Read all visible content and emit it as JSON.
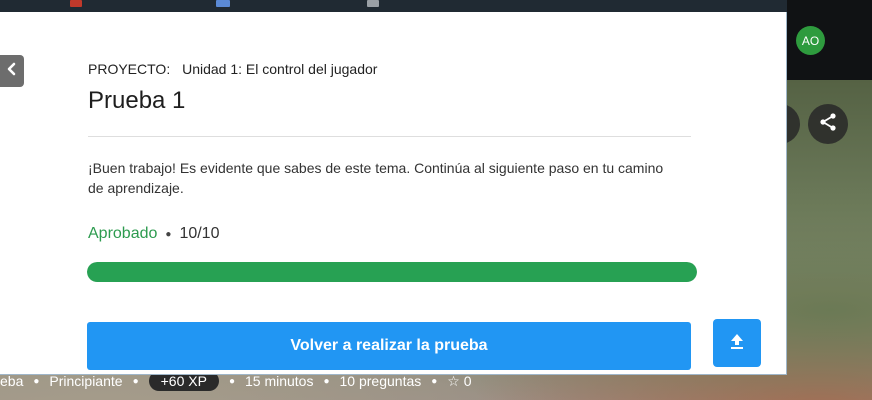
{
  "colors": {
    "accent": "#2196f3",
    "success": "#27a153",
    "avatar_bg": "#2e9b3e"
  },
  "user": {
    "initials": "AO"
  },
  "modal": {
    "project_label": "PROYECTO:",
    "project_name": "Unidad 1: El control del jugador",
    "title": "Prueba 1",
    "message": "¡Buen trabajo! Es evidente que sabes de este tema. Continúa al siguiente paso en tu camino de aprendizaje.",
    "status": "Aprobado",
    "score": "10/10",
    "progress_fraction": 1.0,
    "retry_label": "Volver a realizar la prueba",
    "back_icon": "chevron-left-icon",
    "upload_icon": "upload-icon"
  },
  "meta": {
    "type": "eba",
    "level": "Principiante",
    "xp": "+60 XP",
    "duration": "15 minutos",
    "questions": "10 preguntas",
    "stars": "0"
  },
  "actions": {
    "share_icon": "share-icon"
  }
}
